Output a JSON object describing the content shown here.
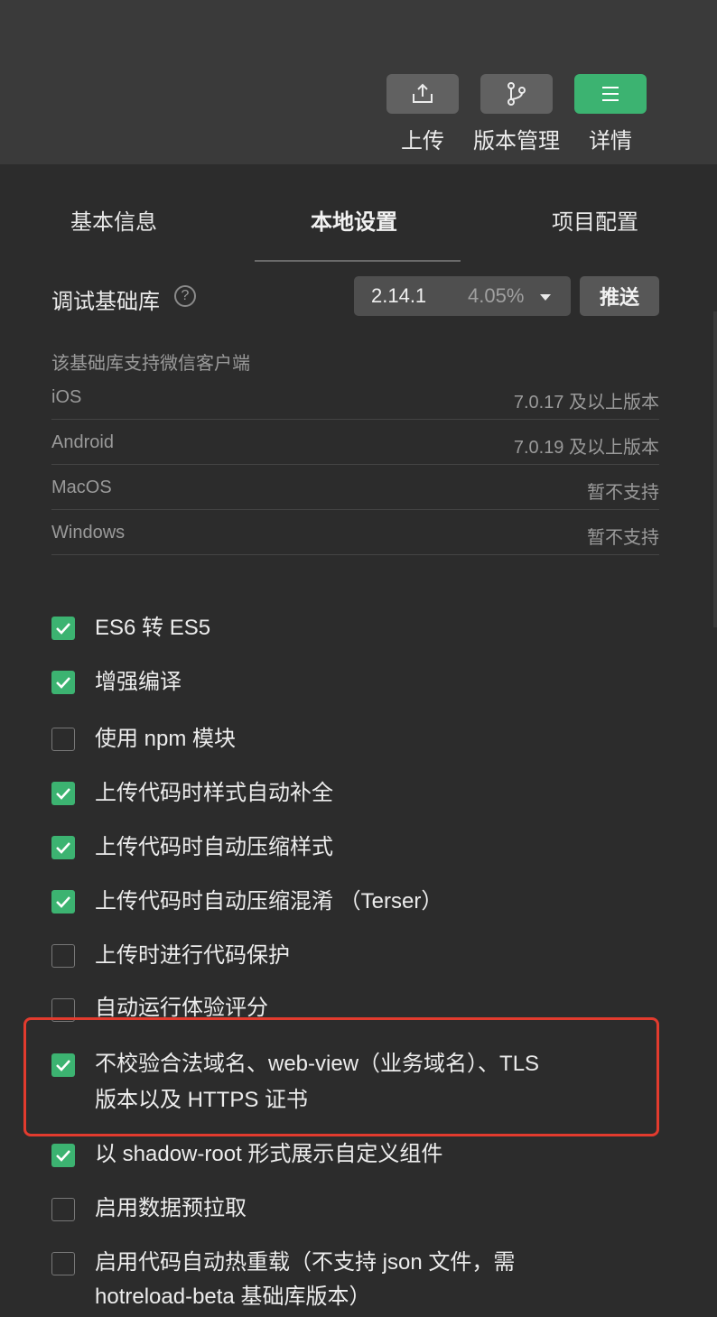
{
  "toolbar": {
    "upload_label": "上传",
    "version_label": "版本管理",
    "details_label": "详情"
  },
  "tabs": [
    {
      "label": "基本信息"
    },
    {
      "label": "本地设置"
    },
    {
      "label": "项目配置"
    }
  ],
  "library": {
    "label": "调试基础库",
    "help": "?",
    "version": "2.14.1",
    "percent": "4.05%",
    "push_label": "推送"
  },
  "support": {
    "title": "该基础库支持微信客户端",
    "rows": [
      {
        "name": "iOS",
        "value": "7.0.17 及以上版本"
      },
      {
        "name": "Android",
        "value": "7.0.19 及以上版本"
      },
      {
        "name": "MacOS",
        "value": "暂不支持"
      },
      {
        "name": "Windows",
        "value": "暂不支持"
      }
    ]
  },
  "options": [
    {
      "label": "ES6 转 ES5",
      "checked": true
    },
    {
      "label": "增强编译",
      "checked": true
    },
    {
      "label": "使用 npm 模块",
      "checked": false
    },
    {
      "label": "上传代码时样式自动补全",
      "checked": true
    },
    {
      "label": "上传代码时自动压缩样式",
      "checked": true
    },
    {
      "label": "上传代码时自动压缩混淆 （Terser）",
      "checked": true
    },
    {
      "label": "上传时进行代码保护",
      "checked": false
    },
    {
      "label": "自动运行体验评分",
      "checked": false
    },
    {
      "label": "不校验合法域名、web-view（业务域名）、TLS",
      "label2": "版本以及 HTTPS 证书",
      "checked": true
    },
    {
      "label": "以 shadow-root 形式展示自定义组件",
      "checked": true
    },
    {
      "label": "启用数据预拉取",
      "checked": false
    },
    {
      "label": "启用代码自动热重载（不支持 json 文件，需",
      "label2": "hotreload-beta 基础库版本）",
      "checked": false
    }
  ],
  "colors": {
    "accent_green": "#3cb371",
    "highlight_red": "#e23b2e"
  }
}
